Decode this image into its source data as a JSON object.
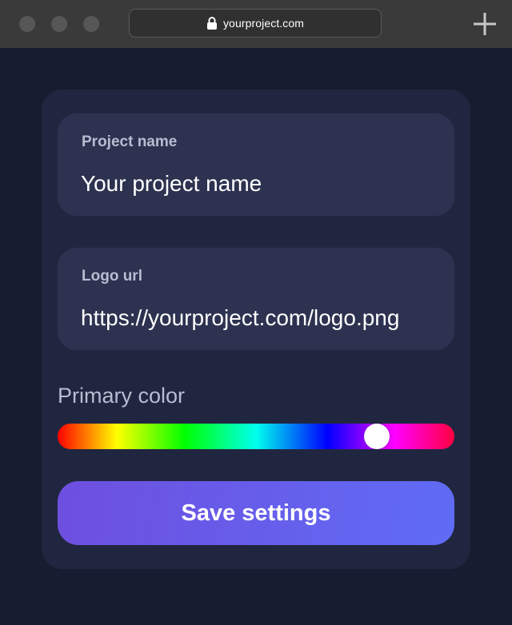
{
  "browser": {
    "url": "yourproject.com",
    "lock_icon": "lock-icon",
    "new_tab_icon": "plus-icon"
  },
  "form": {
    "project_name": {
      "label": "Project name",
      "value": "Your project name"
    },
    "logo_url": {
      "label": "Logo url",
      "value": "https://yourproject.com/logo.png"
    },
    "primary_color": {
      "label": "Primary color",
      "hue_fraction": 0.805
    },
    "save_label": "Save settings"
  },
  "colors": {
    "page_background": "#181c30",
    "card_background": "#212640",
    "field_background": "#2d3250",
    "button_gradient_start": "#6e4fe0",
    "button_gradient_end": "#5f6cf5"
  }
}
